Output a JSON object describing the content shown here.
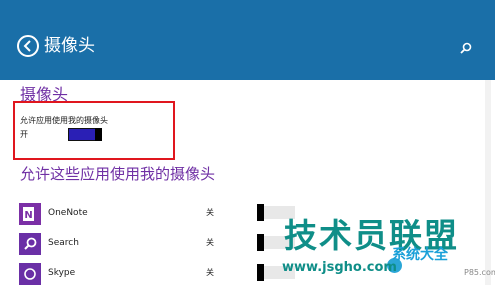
{
  "header": {
    "title": "摄像头",
    "back_icon": "back-arrow-icon",
    "search_icon": "search-icon",
    "color": "#1a6fa8"
  },
  "camera_section": {
    "title": "摄像头",
    "setting_label": "允许应用使用我的摄像头",
    "toggle_state": "开",
    "toggle_on": true
  },
  "apps_section": {
    "title": "允许这些应用使用我的摄像头",
    "items": [
      {
        "name": "OneNote",
        "state": "关",
        "icon": "onenote-icon",
        "color": "#7b2fa6"
      },
      {
        "name": "Search",
        "state": "关",
        "icon": "search-app-icon",
        "color": "#6a2fa6"
      },
      {
        "name": "Skype",
        "state": "关",
        "icon": "skype-icon",
        "color": "#6a2fa6"
      }
    ]
  },
  "watermark": {
    "title": "技术员联盟",
    "url": "www.jsgho.com",
    "side_text": "系统大全",
    "small_text": "P85.com"
  },
  "colors": {
    "accent": "#6f2fa4",
    "highlight_border": "#e0161e",
    "toggle_on": "#2a1fb5"
  }
}
